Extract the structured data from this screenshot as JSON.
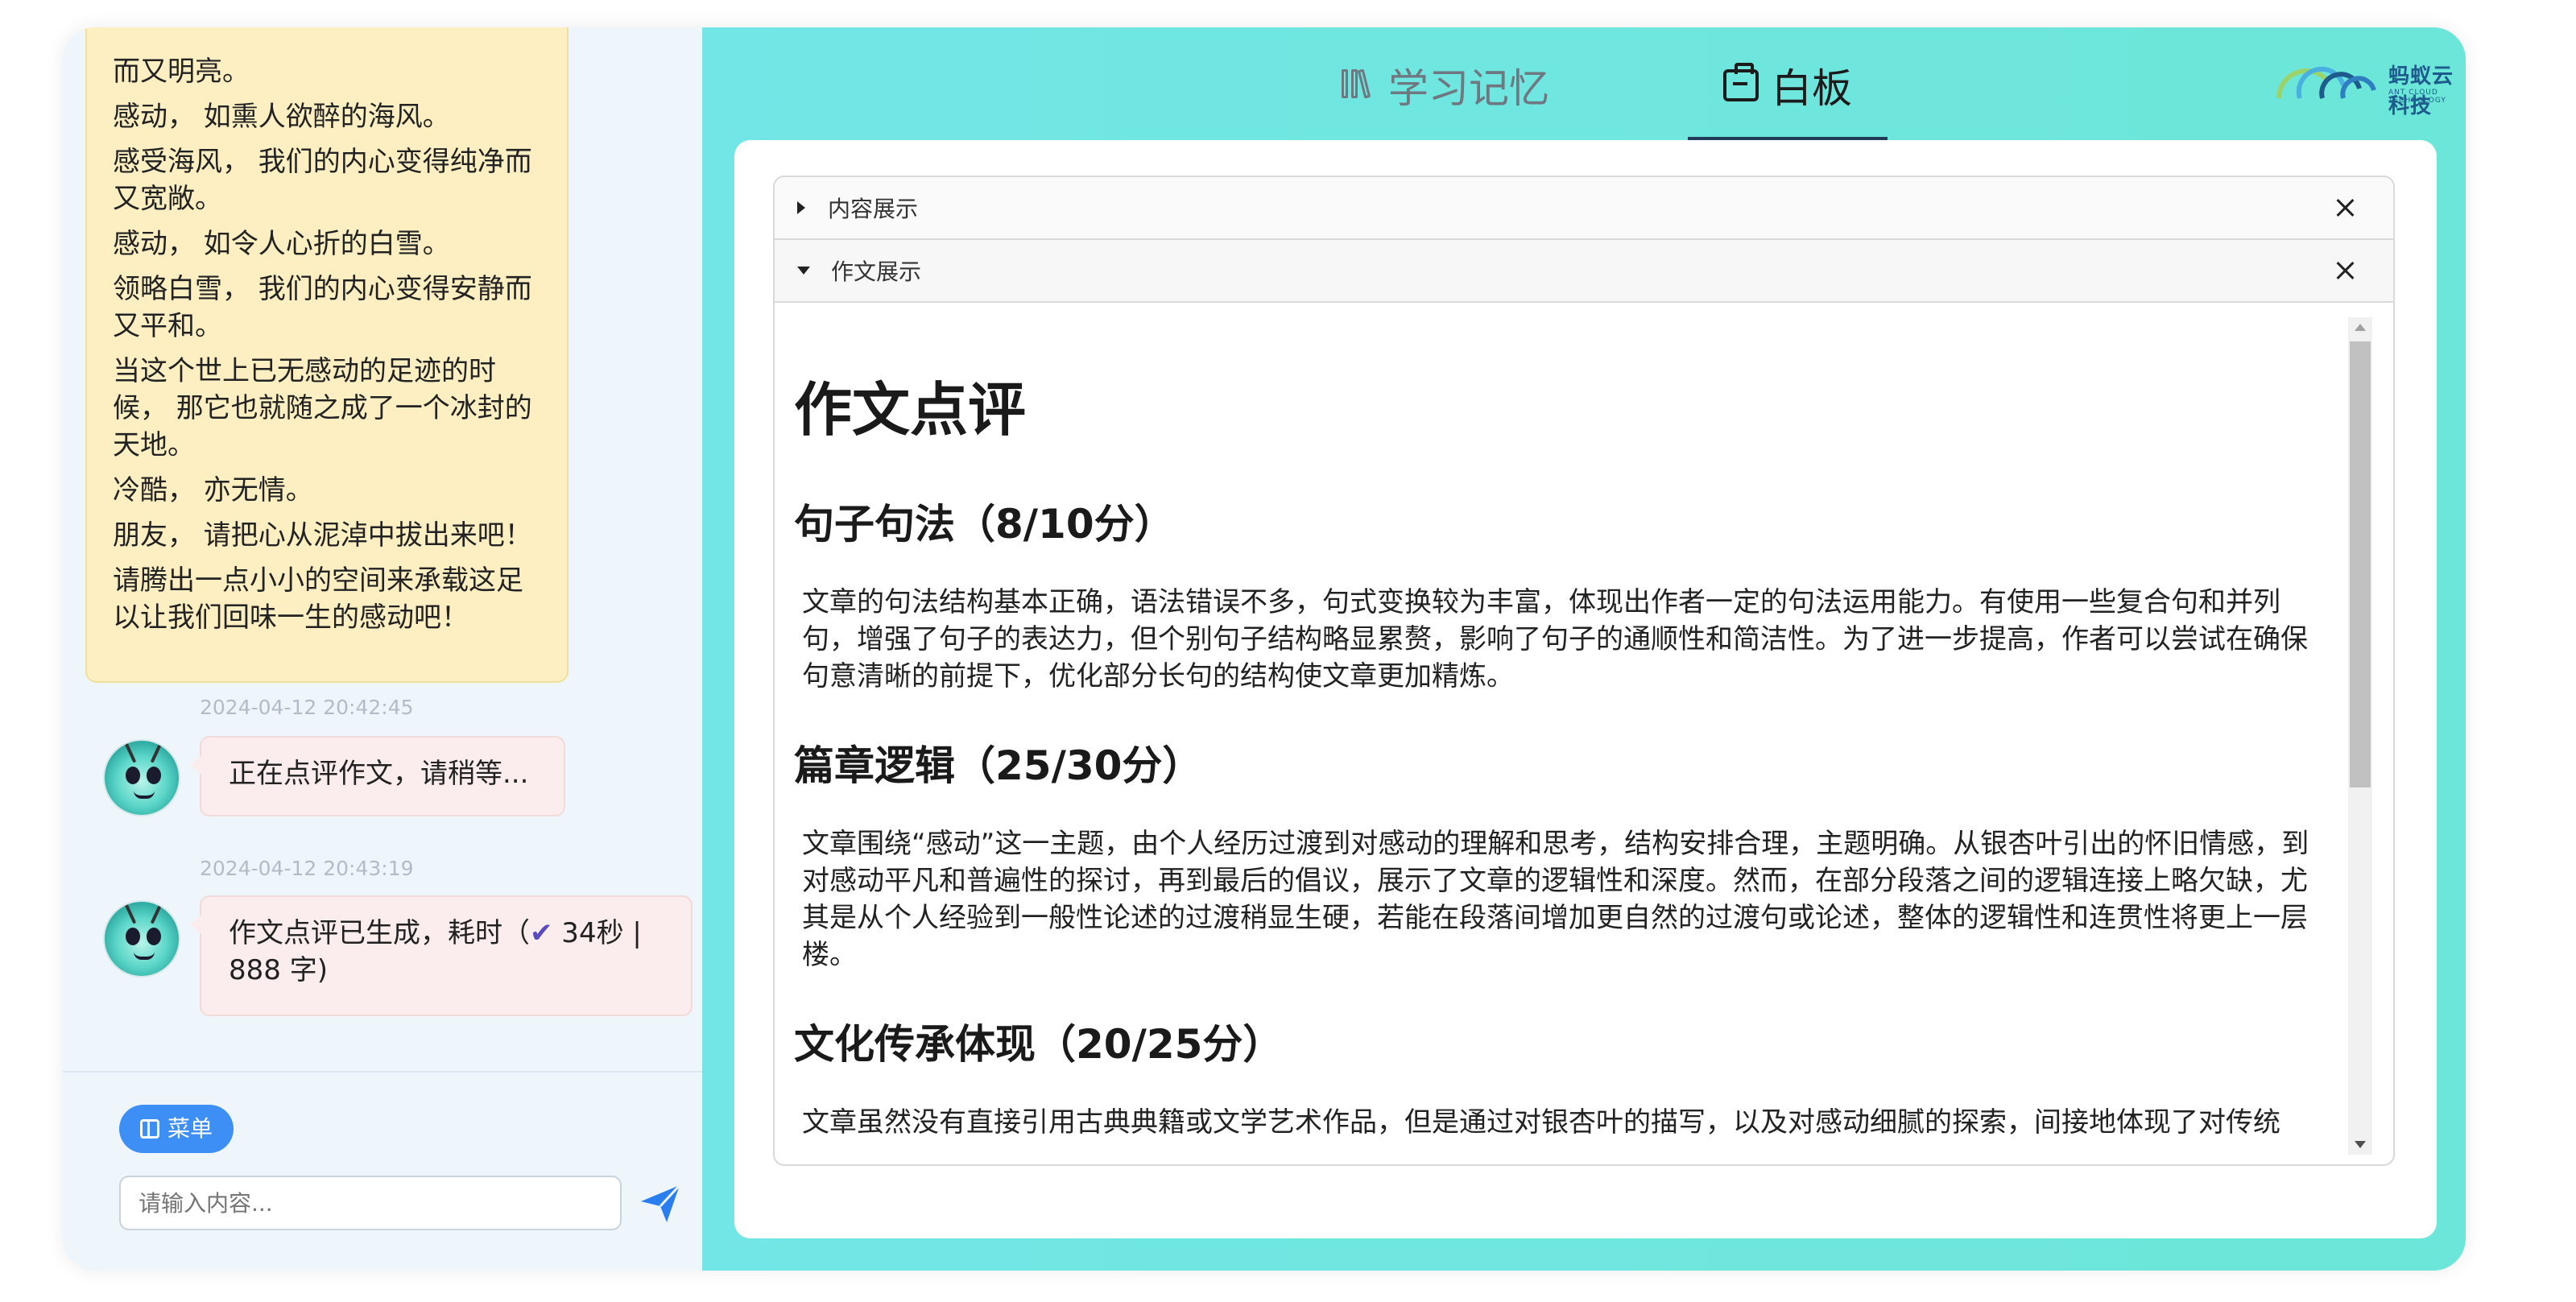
{
  "chat": {
    "essay_lines": [
      "而又明亮。",
      " 感动， 如熏人欲醉的海风。",
      "感受海风， 我们的内心变得纯净而又宽敞。",
      " 感动， 如令人心折的白雪。",
      "领略白雪， 我们的内心变得安静而又平和。",
      " 当这个世上已无感动的足迹的时候， 那它也就随之成了一个冰封的天地。",
      "冷酷， 亦无情。",
      " 朋友， 请把心从泥淖中拔出来吧！",
      "请腾出一点小小的空间来承载这足以让我们回味一生的感动吧！"
    ],
    "messages": [
      {
        "time": "2024-04-12 20:42:45",
        "text": "正在点评作文，请稍等..."
      },
      {
        "time": "2024-04-12 20:43:19",
        "text_prefix": "作文点评已生成，耗时（",
        "check": "✔",
        "text_suffix": " 34秒 | 888 字)"
      }
    ],
    "menu_label": "菜单",
    "input_placeholder": "请输入内容..."
  },
  "tabs": [
    {
      "label": "学习记忆",
      "active": false
    },
    {
      "label": "白板",
      "active": true
    }
  ],
  "brand": {
    "name": "蚂蚁云科技",
    "sub": "ANT CLOUD TECHNOLOGY"
  },
  "whiteboard": {
    "sections": [
      {
        "label": "内容展示",
        "expanded": false
      },
      {
        "label": "作文展示",
        "expanded": true
      }
    ],
    "doc": {
      "title": "作文点评",
      "blocks": [
        {
          "heading": "句子句法（8/10分）",
          "body": "文章的句法结构基本正确，语法错误不多，句式变换较为丰富，体现出作者一定的句法运用能力。有使用一些复合句和并列句，增强了句子的表达力，但个别句子结构略显累赘，影响了句子的通顺性和简洁性。为了进一步提高，作者可以尝试在确保句意清晰的前提下，优化部分长句的结构使文章更加精炼。"
        },
        {
          "heading": "篇章逻辑（25/30分）",
          "body": "文章围绕“感动”这一主题，由个人经历过渡到对感动的理解和思考，结构安排合理，主题明确。从银杏叶引出的怀旧情感，到对感动平凡和普遍性的探讨，再到最后的倡议，展示了文章的逻辑性和深度。然而，在部分段落之间的逻辑连接上略欠缺，尤其是从个人经验到一般性论述的过渡稍显生硬，若能在段落间增加更自然的过渡句或论述，整体的逻辑性和连贯性将更上一层楼。"
        },
        {
          "heading": "文化传承体现（20/25分）",
          "body": "文章虽然没有直接引用古典典籍或文学艺术作品，但是通过对银杏叶的描写，以及对感动细腻的探索，间接地体现了对传统"
        }
      ]
    }
  },
  "colors": {
    "accent": "#3d8ff5",
    "teal_bg": "#6ce6d8",
    "yellow_bubble": "#fdefc1",
    "pink_bubble": "#fbeded"
  }
}
